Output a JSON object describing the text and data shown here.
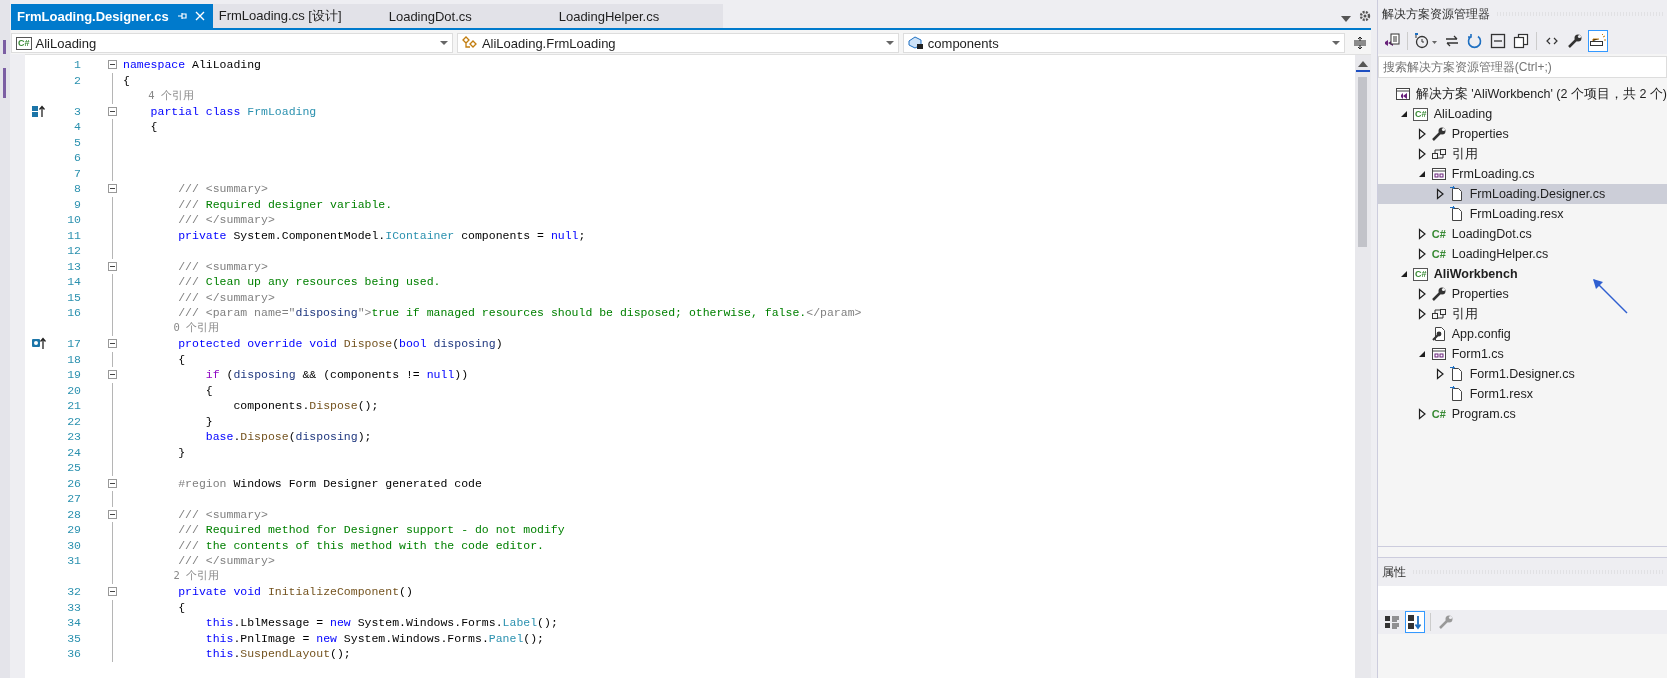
{
  "tabs": [
    {
      "label": "FrmLoading.Designer.cs",
      "selected": true
    },
    {
      "label": "FrmLoading.cs [设计]",
      "selected": false
    },
    {
      "label": "LoadingDot.cs",
      "selected": false
    },
    {
      "label": "LoadingHelper.cs",
      "selected": false
    }
  ],
  "navigation_bar": [
    {
      "kind": "project",
      "icon_text": "C#",
      "text": "AliLoading"
    },
    {
      "kind": "class",
      "text": "AliLoading.FrmLoading"
    },
    {
      "kind": "field",
      "text": "components"
    }
  ],
  "code": [
    {
      "kind": "code",
      "num": "1",
      "fold": true,
      "tokens": [
        {
          "kind": "keyword",
          "text": "namespace"
        },
        {
          "kind": "plain",
          "text": " AliLoading"
        }
      ]
    },
    {
      "kind": "code",
      "num": "2",
      "fold": false,
      "tokens": [
        {
          "kind": "plain",
          "text": "{"
        }
      ]
    },
    {
      "kind": "ref",
      "text": "    4 个引用"
    },
    {
      "kind": "code",
      "num": "3",
      "fold": true,
      "margin_glyph": {
        "kind": "implementation"
      },
      "tokens": [
        {
          "kind": "keyword",
          "text": "    partial"
        },
        {
          "kind": "keyword",
          "text": " class"
        },
        {
          "kind": "type",
          "text": " FrmLoading"
        }
      ]
    },
    {
      "kind": "code",
      "num": "4",
      "fold": false,
      "tokens": [
        {
          "kind": "plain",
          "text": "    {"
        }
      ]
    },
    {
      "kind": "code",
      "num": "5",
      "fold": false
    },
    {
      "kind": "code",
      "num": "6",
      "fold": false
    },
    {
      "kind": "code",
      "num": "7",
      "fold": false
    },
    {
      "kind": "code",
      "num": "8",
      "fold": true,
      "tokens": [
        {
          "kind": "doc",
          "text": "        /// <summary>"
        }
      ]
    },
    {
      "kind": "code",
      "num": "9",
      "fold": false,
      "tokens": [
        {
          "kind": "doc",
          "text": "        /// "
        },
        {
          "kind": "comment",
          "text": "Required designer variable."
        }
      ]
    },
    {
      "kind": "code",
      "num": "10",
      "fold": false,
      "tokens": [
        {
          "kind": "doc",
          "text": "        /// </summary>"
        }
      ]
    },
    {
      "kind": "code",
      "num": "11",
      "fold": false,
      "tokens": [
        {
          "kind": "keyword",
          "text": "        private"
        },
        {
          "kind": "plain",
          "text": " System.ComponentModel."
        },
        {
          "kind": "type",
          "text": "IContainer"
        },
        {
          "kind": "plain",
          "text": " components = "
        },
        {
          "kind": "keyword",
          "text": "null"
        },
        {
          "kind": "plain",
          "text": ";"
        }
      ]
    },
    {
      "kind": "code",
      "num": "12",
      "fold": false
    },
    {
      "kind": "code",
      "num": "13",
      "fold": true,
      "tokens": [
        {
          "kind": "doc",
          "text": "        /// <summary>"
        }
      ]
    },
    {
      "kind": "code",
      "num": "14",
      "fold": false,
      "tokens": [
        {
          "kind": "doc",
          "text": "        /// "
        },
        {
          "kind": "comment",
          "text": "Clean up any resources being used."
        }
      ]
    },
    {
      "kind": "code",
      "num": "15",
      "fold": false,
      "tokens": [
        {
          "kind": "doc",
          "text": "        /// </summary>"
        }
      ]
    },
    {
      "kind": "code",
      "num": "16",
      "fold": false,
      "tokens": [
        {
          "kind": "doc",
          "text": "        /// <param name=\""
        },
        {
          "kind": "param",
          "text": "disposing"
        },
        {
          "kind": "doc",
          "text": "\">"
        },
        {
          "kind": "comment",
          "text": "true if managed resources should be disposed; otherwise, false."
        },
        {
          "kind": "doc",
          "text": "</param>"
        }
      ]
    },
    {
      "kind": "ref",
      "text": "        0 个引用"
    },
    {
      "kind": "code",
      "num": "17",
      "fold": true,
      "margin_glyph": {
        "kind": "override"
      },
      "tokens": [
        {
          "kind": "keyword",
          "text": "        protected override void"
        },
        {
          "kind": "method",
          "text": " Dispose"
        },
        {
          "kind": "plain",
          "text": "("
        },
        {
          "kind": "keyword",
          "text": "bool"
        },
        {
          "kind": "param",
          "text": " disposing"
        },
        {
          "kind": "plain",
          "text": ")"
        }
      ]
    },
    {
      "kind": "code",
      "num": "18",
      "fold": false,
      "tokens": [
        {
          "kind": "plain",
          "text": "        {"
        }
      ]
    },
    {
      "kind": "code",
      "num": "19",
      "fold": true,
      "tokens": [
        {
          "kind": "control",
          "text": "            if"
        },
        {
          "kind": "plain",
          "text": " ("
        },
        {
          "kind": "param",
          "text": "disposing"
        },
        {
          "kind": "plain",
          "text": " && (components != "
        },
        {
          "kind": "keyword",
          "text": "null"
        },
        {
          "kind": "plain",
          "text": "))"
        }
      ]
    },
    {
      "kind": "code",
      "num": "20",
      "fold": false,
      "tokens": [
        {
          "kind": "plain",
          "text": "            {"
        }
      ]
    },
    {
      "kind": "code",
      "num": "21",
      "fold": false,
      "tokens": [
        {
          "kind": "plain",
          "text": "                components."
        },
        {
          "kind": "method",
          "text": "Dispose"
        },
        {
          "kind": "plain",
          "text": "();"
        }
      ]
    },
    {
      "kind": "code",
      "num": "22",
      "fold": false,
      "tokens": [
        {
          "kind": "plain",
          "text": "            }"
        }
      ]
    },
    {
      "kind": "code",
      "num": "23",
      "fold": false,
      "tokens": [
        {
          "kind": "keyword",
          "text": "            base"
        },
        {
          "kind": "plain",
          "text": "."
        },
        {
          "kind": "method",
          "text": "Dispose"
        },
        {
          "kind": "plain",
          "text": "("
        },
        {
          "kind": "param",
          "text": "disposing"
        },
        {
          "kind": "plain",
          "text": ");"
        }
      ]
    },
    {
      "kind": "code",
      "num": "24",
      "fold": false,
      "tokens": [
        {
          "kind": "plain",
          "text": "        }"
        }
      ]
    },
    {
      "kind": "code",
      "num": "25",
      "fold": false
    },
    {
      "kind": "code",
      "num": "26",
      "fold": true,
      "tokens": [
        {
          "kind": "doc",
          "text": "        #region"
        },
        {
          "kind": "plain",
          "text": " Windows Form Designer generated code"
        }
      ]
    },
    {
      "kind": "code",
      "num": "27",
      "fold": false
    },
    {
      "kind": "code",
      "num": "28",
      "fold": true,
      "tokens": [
        {
          "kind": "doc",
          "text": "        /// <summary>"
        }
      ]
    },
    {
      "kind": "code",
      "num": "29",
      "fold": false,
      "tokens": [
        {
          "kind": "doc",
          "text": "        /// "
        },
        {
          "kind": "comment",
          "text": "Required method for Designer support - do not modify"
        }
      ]
    },
    {
      "kind": "code",
      "num": "30",
      "fold": false,
      "tokens": [
        {
          "kind": "doc",
          "text": "        /// "
        },
        {
          "kind": "comment",
          "text": "the contents of this method with the code editor."
        }
      ]
    },
    {
      "kind": "code",
      "num": "31",
      "fold": false,
      "tokens": [
        {
          "kind": "doc",
          "text": "        /// </summary>"
        }
      ]
    },
    {
      "kind": "ref",
      "text": "        2 个引用"
    },
    {
      "kind": "code",
      "num": "32",
      "fold": true,
      "tokens": [
        {
          "kind": "keyword",
          "text": "        private void"
        },
        {
          "kind": "method",
          "text": " InitializeComponent"
        },
        {
          "kind": "plain",
          "text": "()"
        }
      ]
    },
    {
      "kind": "code",
      "num": "33",
      "fold": false,
      "tokens": [
        {
          "kind": "plain",
          "text": "        {"
        }
      ]
    },
    {
      "kind": "code",
      "num": "34",
      "fold": false,
      "tokens": [
        {
          "kind": "keyword",
          "text": "            this"
        },
        {
          "kind": "plain",
          "text": ".LblMessage = "
        },
        {
          "kind": "keyword",
          "text": "new"
        },
        {
          "kind": "plain",
          "text": " System.Windows.Forms."
        },
        {
          "kind": "type",
          "text": "Label"
        },
        {
          "kind": "plain",
          "text": "();"
        }
      ]
    },
    {
      "kind": "code",
      "num": "35",
      "fold": false,
      "tokens": [
        {
          "kind": "keyword",
          "text": "            this"
        },
        {
          "kind": "plain",
          "text": ".PnlImage = "
        },
        {
          "kind": "keyword",
          "text": "new"
        },
        {
          "kind": "plain",
          "text": " System.Windows.Forms."
        },
        {
          "kind": "type",
          "text": "Panel"
        },
        {
          "kind": "plain",
          "text": "();"
        }
      ]
    },
    {
      "kind": "code",
      "num": "36",
      "fold": false,
      "tokens": [
        {
          "kind": "keyword",
          "text": "            this"
        },
        {
          "kind": "plain",
          "text": "."
        },
        {
          "kind": "method",
          "text": "SuspendLayout"
        },
        {
          "kind": "plain",
          "text": "();"
        }
      ]
    }
  ],
  "solution_explorer": {
    "title": "解决方案资源管理器",
    "toolbar": [
      {
        "kind": "switch-views",
        "on": false
      },
      {
        "kind": "history",
        "on": false
      },
      {
        "kind": "sync",
        "on": false
      },
      {
        "kind": "refresh",
        "on": false
      },
      {
        "kind": "collapse",
        "on": false
      },
      {
        "kind": "show-all",
        "on": false
      },
      {
        "kind": "code",
        "on": false
      },
      {
        "kind": "properties",
        "on": false
      },
      {
        "kind": "preview",
        "on": true
      }
    ],
    "search": {
      "placeholder": "搜索解决方案资源管理器(Ctrl+;)"
    },
    "tree": [
      {
        "kind": "solution",
        "label": "解决方案 'AliWorkbench' (2 个项目，共 2 个)",
        "expandable": false,
        "selected": false,
        "bold": false,
        "children": [
          {
            "kind": "project",
            "icon_text": "C#",
            "label": "AliLoading",
            "expandable": true,
            "expanded": true,
            "selected": false,
            "bold": false,
            "children": [
              {
                "kind": "properties",
                "label": "Properties",
                "expandable": true,
                "expanded": false,
                "selected": false,
                "bold": false
              },
              {
                "kind": "references",
                "label": "引用",
                "expandable": true,
                "expanded": false,
                "selected": false,
                "bold": false
              },
              {
                "kind": "form",
                "label": "FrmLoading.cs",
                "expandable": true,
                "expanded": true,
                "selected": false,
                "bold": false,
                "children": [
                  {
                    "kind": "file",
                    "label": "FrmLoading.Designer.cs",
                    "expandable": true,
                    "expanded": false,
                    "selected": true,
                    "bold": false
                  },
                  {
                    "kind": "file",
                    "label": "FrmLoading.resx",
                    "expandable": false,
                    "selected": false,
                    "bold": false
                  }
                ]
              },
              {
                "kind": "code-file",
                "icon_text": "C#",
                "label": "LoadingDot.cs",
                "expandable": true,
                "expanded": false,
                "selected": false,
                "bold": false
              },
              {
                "kind": "code-file",
                "icon_text": "C#",
                "label": "LoadingHelper.cs",
                "expandable": true,
                "expanded": false,
                "selected": false,
                "bold": false
              }
            ]
          },
          {
            "kind": "project",
            "icon_text": "C#",
            "label": "AliWorkbench",
            "expandable": true,
            "expanded": true,
            "selected": false,
            "bold": true,
            "children": [
              {
                "kind": "properties",
                "label": "Properties",
                "expandable": true,
                "expanded": false,
                "selected": false,
                "bold": false
              },
              {
                "kind": "references",
                "label": "引用",
                "expandable": true,
                "expanded": false,
                "selected": false,
                "bold": false
              },
              {
                "kind": "config",
                "label": "App.config",
                "expandable": false,
                "selected": false,
                "bold": false
              },
              {
                "kind": "form",
                "label": "Form1.cs",
                "expandable": true,
                "expanded": true,
                "selected": false,
                "bold": false,
                "children": [
                  {
                    "kind": "file",
                    "label": "Form1.Designer.cs",
                    "expandable": true,
                    "expanded": false,
                    "selected": false,
                    "bold": false
                  },
                  {
                    "kind": "file",
                    "label": "Form1.resx",
                    "expandable": false,
                    "selected": false,
                    "bold": false
                  }
                ]
              },
              {
                "kind": "code-file",
                "icon_text": "C#",
                "label": "Program.cs",
                "expandable": true,
                "expanded": false,
                "selected": false,
                "bold": false
              }
            ]
          }
        ]
      }
    ]
  },
  "properties": {
    "title": "属性",
    "toolbar": [
      {
        "kind": "categorized",
        "on": false
      },
      {
        "kind": "alphabetical",
        "on": true
      },
      {
        "kind": "property-pages",
        "on": false
      }
    ]
  }
}
